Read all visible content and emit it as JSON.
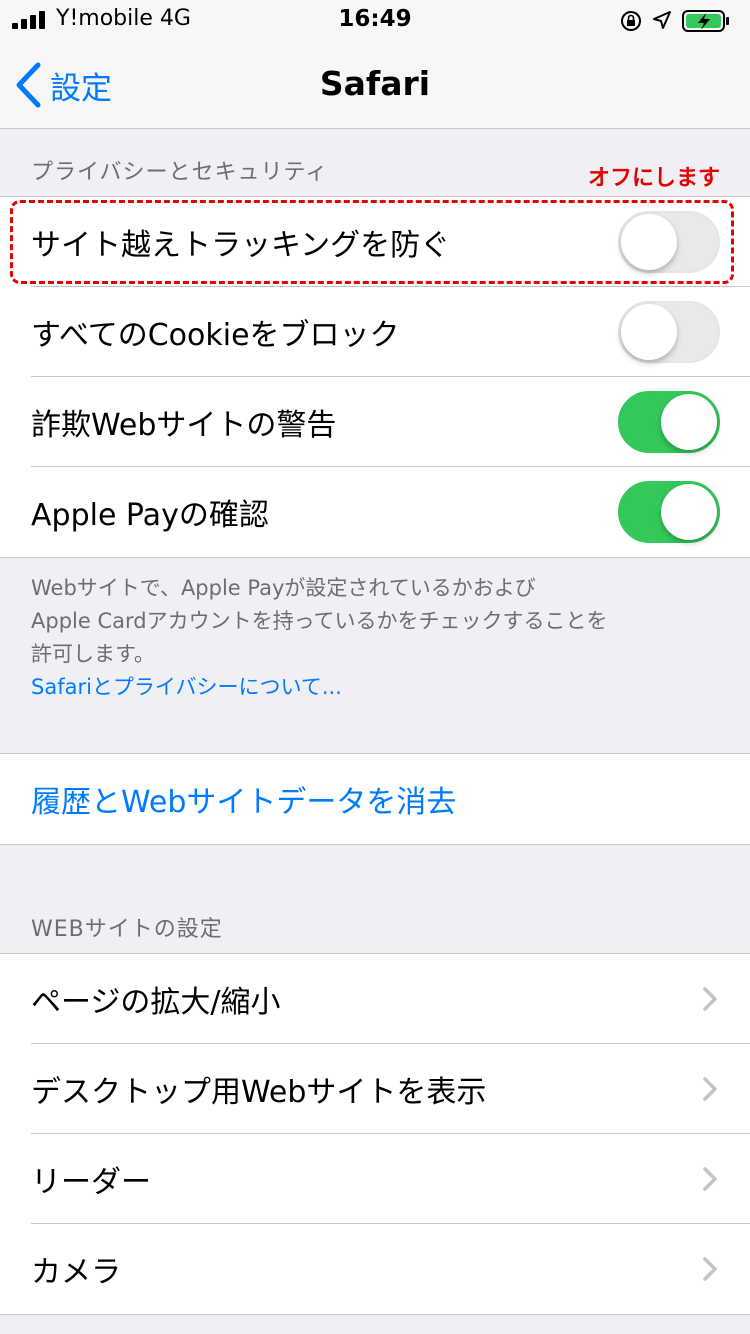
{
  "status_bar": {
    "carrier": "Y!mobile  4G",
    "time": "16:49",
    "icons": [
      "signal-icon",
      "orientation-lock-icon",
      "location-icon",
      "battery-charging-icon"
    ]
  },
  "nav": {
    "back_label": "設定",
    "title": "Safari"
  },
  "privacy": {
    "header": "プライバシーとセキュリティ",
    "rows": [
      {
        "label": "サイト越えトラッキングを防ぐ",
        "on": false
      },
      {
        "label": "すべてのCookieをブロック",
        "on": false
      },
      {
        "label": "詐欺Webサイトの警告",
        "on": true
      },
      {
        "label": "Apple Payの確認",
        "on": true
      }
    ],
    "footer_line1": "Webサイトで、Apple Payが設定されているかおよび",
    "footer_line2": "Apple Cardアカウントを持っているかをチェックすることを",
    "footer_line3": "許可します。",
    "footer_link": "Safariとプライバシーについて..."
  },
  "clear_history": {
    "label": "履歴とWebサイトデータを消去"
  },
  "website_settings": {
    "header": "WEBサイトの設定",
    "rows": [
      {
        "label": "ページの拡大/縮小"
      },
      {
        "label": "デスクトップ用Webサイトを表示"
      },
      {
        "label": "リーダー"
      },
      {
        "label": "カメラ"
      }
    ]
  },
  "annotation": {
    "label": "オフにします"
  },
  "colors": {
    "accent": "#007aff",
    "toggle_on": "#34c759",
    "annotation": "#e60000"
  }
}
